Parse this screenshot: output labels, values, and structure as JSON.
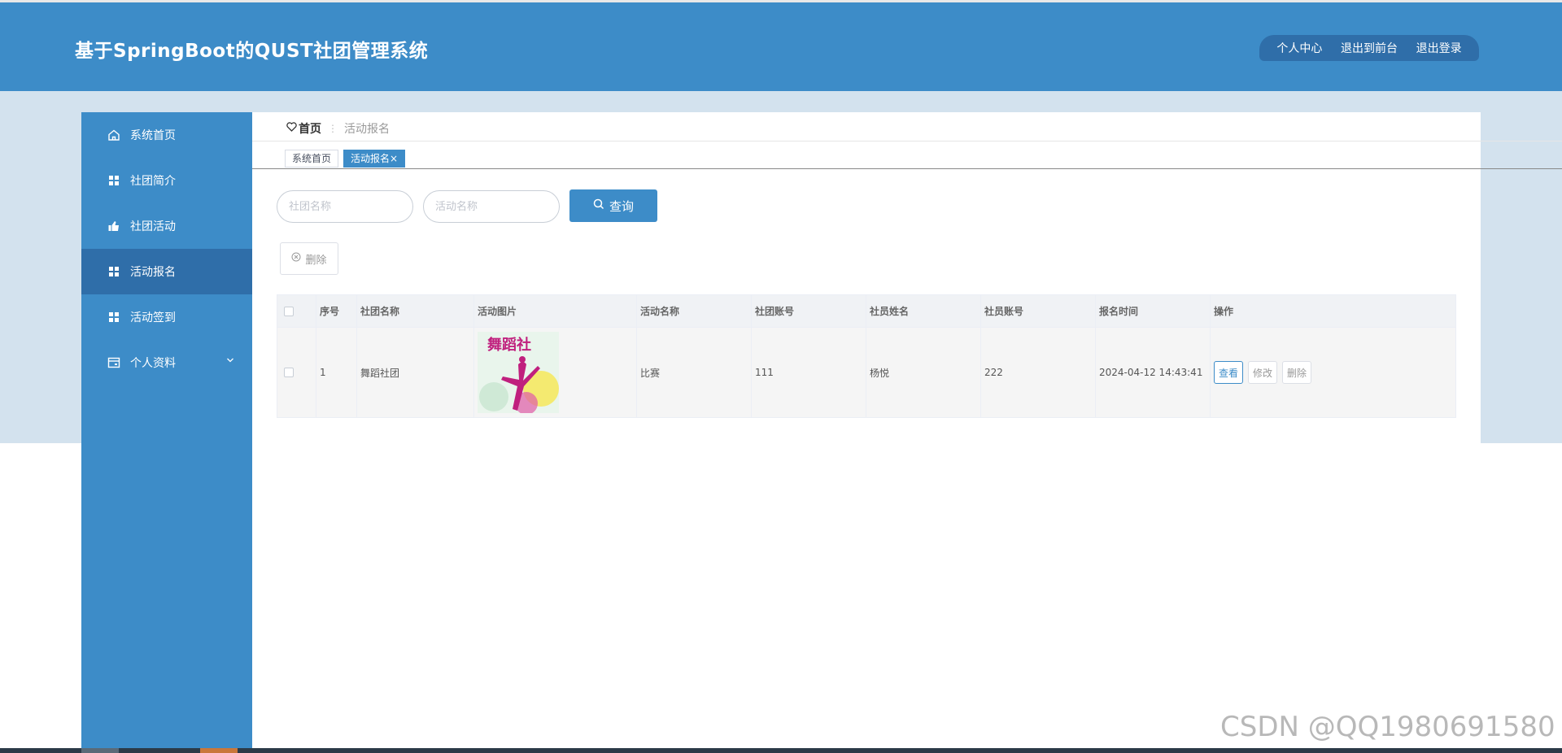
{
  "app": {
    "title": "基于SpringBoot的QUST社团管理系统"
  },
  "top_nav": {
    "profile": "个人中心",
    "frontend": "退出到前台",
    "logout": "退出登录"
  },
  "sidebar": {
    "items": [
      {
        "label": "系统首页",
        "icon": "home-icon"
      },
      {
        "label": "社团简介",
        "icon": "grid-icon"
      },
      {
        "label": "社团活动",
        "icon": "thumb-icon"
      },
      {
        "label": "活动报名",
        "icon": "grid-icon",
        "active": true
      },
      {
        "label": "活动签到",
        "icon": "grid-icon"
      },
      {
        "label": "个人资料",
        "icon": "card-icon",
        "expandable": true
      }
    ]
  },
  "breadcrumb": {
    "home": "首页",
    "current": "活动报名"
  },
  "tabs": [
    {
      "label": "系统首页"
    },
    {
      "label": "活动报名",
      "close": "×",
      "active": true
    }
  ],
  "search": {
    "club_name_placeholder": "社团名称",
    "activity_name_placeholder": "活动名称",
    "query_label": "查询"
  },
  "actions": {
    "delete_label": "删除"
  },
  "table": {
    "headers": [
      "序号",
      "社团名称",
      "活动图片",
      "活动名称",
      "社团账号",
      "社员姓名",
      "社员账号",
      "报名时间",
      "操作"
    ],
    "rows": [
      {
        "index": "1",
        "club_name": "舞蹈社团",
        "image_caption": "舞蹈社",
        "activity_name": "比赛",
        "club_account": "111",
        "member_name": "杨悦",
        "member_account": "222",
        "signup_time": "2024-04-12 14:43:41",
        "ops": {
          "view": "查看",
          "edit": "修改",
          "delete": "删除"
        }
      }
    ]
  },
  "watermark": "CSDN @QQ1980691580",
  "colors": {
    "primary": "#3d8cc8",
    "primary_dark": "#2f6ea9",
    "band": "#d3e2ee"
  }
}
